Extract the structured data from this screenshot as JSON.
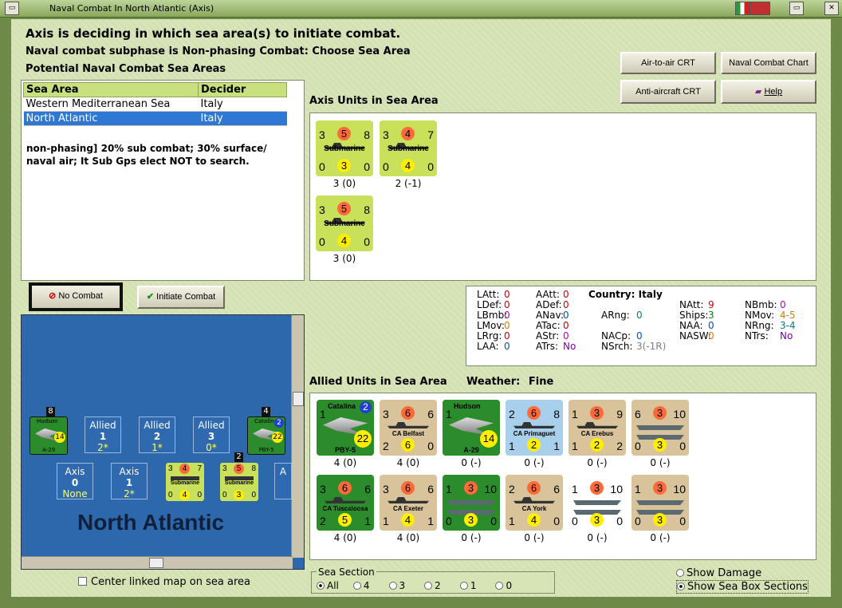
{
  "window": {
    "title": "Naval Combat In North Atlantic (Axis)"
  },
  "header": {
    "line1": "Axis is deciding in which sea area(s) to initiate combat.",
    "line2": "Naval combat subphase is Non-phasing Combat: Choose Sea Area",
    "line3": "Potential Naval Combat Sea Areas"
  },
  "buttons": {
    "air_to_air": "Air-to-air CRT",
    "naval_chart": "Naval Combat Chart",
    "anti_aircraft": "Anti-aircraft CRT",
    "help": "Help",
    "no_combat": "No Combat",
    "initiate": "Initiate Combat"
  },
  "sea_table": {
    "headers": [
      "Sea Area",
      "Decider"
    ],
    "rows": [
      {
        "area": "Western Mediterranean Sea",
        "decider": "Italy"
      },
      {
        "area": "North Atlantic",
        "decider": "Italy"
      }
    ],
    "note": "non-phasing] 20% sub combat; 30% surface/ naval air; It Sub Gps elect NOT to search."
  },
  "axis_units": {
    "title": "Axis Units in Sea Area",
    "counters": [
      {
        "tl": "3",
        "tc": "5",
        "tr": "8",
        "name": "Submarine",
        "bl": "0",
        "bc": "3",
        "br": "0",
        "caption": "3 (0)"
      },
      {
        "tl": "3",
        "tc": "4",
        "tr": "7",
        "name": "Submarine",
        "bl": "0",
        "bc": "4",
        "br": "0",
        "caption": "2 (-1)"
      },
      {
        "tl": "3",
        "tc": "5",
        "tr": "8",
        "name": "Submarine",
        "bl": "0",
        "bc": "4",
        "br": "0",
        "caption": "3 (0)"
      }
    ]
  },
  "stats": {
    "country_label": "Country:",
    "country": "Italy",
    "items": [
      {
        "k": "LAtt:",
        "v": "0",
        "c": "#d00000"
      },
      {
        "k": "LDef:",
        "v": "0",
        "c": "#d00000"
      },
      {
        "k": "LBmb:",
        "v": "0",
        "c": "#c000c0"
      },
      {
        "k": "LMov:",
        "v": "0",
        "c": "#d08000"
      },
      {
        "k": "LRrg:",
        "v": "0",
        "c": "#d00000"
      },
      {
        "k": "LAA:",
        "v": "0",
        "c": "#0050c0"
      },
      {
        "k": "AAtt:",
        "v": "0",
        "c": "#d00000"
      },
      {
        "k": "ADef:",
        "v": "0",
        "c": "#d00000"
      },
      {
        "k": "ANav:",
        "v": "0",
        "c": "#0050c0"
      },
      {
        "k": "ATac:",
        "v": "0",
        "c": "#d00000"
      },
      {
        "k": "AStr:",
        "v": "0",
        "c": "#c000c0"
      },
      {
        "k": "ATrs:",
        "v": "No",
        "c": "#8000a0"
      },
      {
        "k": "ARng:",
        "v": "0",
        "c": "#008080"
      },
      {
        "k": "NACp:",
        "v": "0",
        "c": "#0050c0"
      },
      {
        "k": "NSrch:",
        "v": "3(-1R)",
        "c": "#808080"
      },
      {
        "k": "NAtt:",
        "v": "9",
        "c": "#d00000"
      },
      {
        "k": "Ships:",
        "v": "3",
        "c": "#008000"
      },
      {
        "k": "NAA:",
        "v": "0",
        "c": "#0050c0"
      },
      {
        "k": "NASW:",
        "v": "0",
        "c": "#d08000"
      },
      {
        "k": "NBmb:",
        "v": "0",
        "c": "#c000c0"
      },
      {
        "k": "NMov:",
        "v": "4-5",
        "c": "#d08000"
      },
      {
        "k": "NRng:",
        "v": "3-4",
        "c": "#008080"
      },
      {
        "k": "NTrs:",
        "v": "No",
        "c": "#8000a0"
      }
    ]
  },
  "allied_units": {
    "title": "Allied Units in Sea Area",
    "weather_label": "Weather:",
    "weather": "Fine",
    "counters": [
      {
        "tl": "1",
        "tc": "Catalina",
        "tr": "2",
        "name": "PBY-5",
        "bl": "",
        "bc": "22",
        "br": "",
        "caption": "4 (0)",
        "bg": "#2a8c2a",
        "kind": "air"
      },
      {
        "tl": "3",
        "tc": "6",
        "tr": "6",
        "name": "CA Belfast",
        "bl": "2",
        "bc": "6",
        "br": "0",
        "caption": "4 (0)",
        "bg": "#d8c39a",
        "kind": "ship"
      },
      {
        "tl": "1",
        "tc": "Hudson",
        "tr": "",
        "name": "A-29",
        "bl": "",
        "bc": "14",
        "br": "",
        "caption": "0 (-)",
        "bg": "#2a8c2a",
        "kind": "air"
      },
      {
        "tl": "2",
        "tc": "6",
        "tr": "8",
        "name": "CA Primaguet",
        "bl": "1",
        "bc": "2",
        "br": "1",
        "caption": "0 (-)",
        "bg": "#a8d0ec",
        "kind": "ship"
      },
      {
        "tl": "1",
        "tc": "3",
        "tr": "9",
        "name": "CA Erebus",
        "bl": "1",
        "bc": "2",
        "br": "2",
        "caption": "0 (-)",
        "bg": "#d8c39a",
        "kind": "ship"
      },
      {
        "tl": "6",
        "tc": "3",
        "tr": "10",
        "name": "",
        "bl": "0",
        "bc": "3",
        "br": "0",
        "caption": "0 (-)",
        "bg": "#d8c39a",
        "kind": "group"
      },
      {
        "tl": "3",
        "tc": "6",
        "tr": "6",
        "name": "CA Tuscaloosa",
        "bl": "2",
        "bc": "5",
        "br": "1",
        "caption": "4 (0)",
        "bg": "#2a8c2a",
        "kind": "ship"
      },
      {
        "tl": "3",
        "tc": "6",
        "tr": "6",
        "name": "CA Exeter",
        "bl": "1",
        "bc": "4",
        "br": "1",
        "caption": "4 (0)",
        "bg": "#d8c39a",
        "kind": "ship"
      },
      {
        "tl": "1",
        "tc": "3",
        "tr": "10",
        "name": "",
        "bl": "0",
        "bc": "3",
        "br": "0",
        "caption": "0 (-)",
        "bg": "#2a8c2a",
        "kind": "group"
      },
      {
        "tl": "2",
        "tc": "6",
        "tr": "6",
        "name": "CA York",
        "bl": "1",
        "bc": "4",
        "br": "0",
        "caption": "0 (-)",
        "bg": "#d8c39a",
        "kind": "ship"
      },
      {
        "tl": "1",
        "tc": "3",
        "tr": "10",
        "name": "",
        "bl": "0",
        "bc": "3",
        "br": "0",
        "caption": "0 (-)",
        "bg": "#ffffff",
        "kind": "group"
      },
      {
        "tl": "1",
        "tc": "3",
        "tr": "10",
        "name": "",
        "bl": "0",
        "bc": "3",
        "br": "0",
        "caption": "0 (-)",
        "bg": "#d8c39a",
        "kind": "group"
      }
    ]
  },
  "map": {
    "title": "North Atlantic",
    "allied_boxes": [
      {
        "label": "Allied",
        "num": "1",
        "val": "2*"
      },
      {
        "label": "Allied",
        "num": "2",
        "val": "1*"
      },
      {
        "label": "Allied",
        "num": "3",
        "val": "0*"
      }
    ],
    "axis_boxes": [
      {
        "label": "Axis",
        "num": "0",
        "val": "None"
      },
      {
        "label": "Axis",
        "num": "1",
        "val": "2*"
      },
      {
        "label": "A",
        "num": "",
        "val": ""
      }
    ],
    "stack_left": "8",
    "stack_right": "4",
    "stack_sub": "2",
    "plane_left": {
      "name": "Hudson",
      "sub": "A-29",
      "val": "14"
    },
    "plane_right": {
      "name": "Catalina",
      "sub": "PBY-5",
      "val": "22",
      "badge": "2"
    },
    "map_subs": [
      {
        "tl": "3",
        "tc": "4",
        "tr": "7",
        "bl": "0",
        "bc": "4",
        "br": "0",
        "name": "Submarine"
      },
      {
        "tl": "3",
        "tc": "5",
        "tr": "8",
        "bl": "0",
        "bc": "3",
        "br": "0",
        "name": "Submarine"
      }
    ]
  },
  "center_link": "Center linked map on sea area",
  "sea_section": {
    "label": "Sea Section",
    "options": [
      "All",
      "4",
      "3",
      "2",
      "1",
      "0"
    ],
    "selected": "All"
  },
  "display_options": {
    "show_damage": "Show Damage",
    "show_sea_box": "Show Sea Box Sections"
  }
}
